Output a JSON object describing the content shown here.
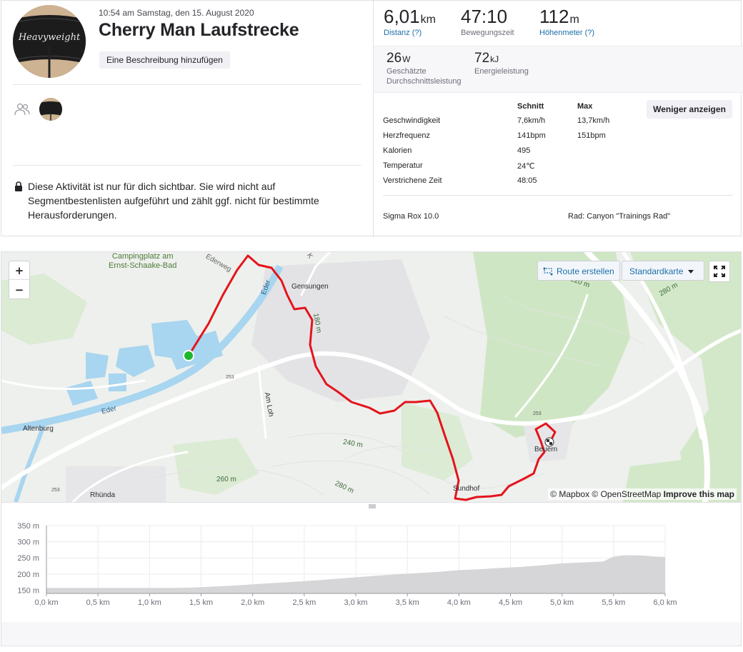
{
  "activity": {
    "datetime": "10:54 am Samstag, den 15. August 2020",
    "title": "Cherry Man Laufstrecke",
    "add_description": "Eine Beschreibung hinzufügen",
    "avatar_text": "Heavyweight",
    "privacy_note": "Diese Aktivität ist nur für dich sichtbar. Sie wird nicht auf Segmentbestenlisten aufgeführt und zählt ggf. nicht für bestimmte Herausforderungen."
  },
  "stats": {
    "distance": {
      "value": "6,01",
      "unit": "km",
      "label": "Distanz (?)"
    },
    "moving_time": {
      "value": "47:10",
      "label": "Bewegungszeit"
    },
    "elevation": {
      "value": "112",
      "unit": "m",
      "label": "Höhenmeter (?)"
    },
    "power": {
      "value": "26",
      "unit": "W",
      "label_1": "Geschätzte",
      "label_2": "Durchschnittsleistung"
    },
    "energy": {
      "value": "72",
      "unit": "kJ",
      "label": "Energieleistung"
    }
  },
  "details": {
    "col_avg": "Schnitt",
    "col_max": "Max",
    "less_button": "Weniger anzeigen",
    "rows": [
      {
        "label": "Geschwindigkeit",
        "avg": "7,6km/h",
        "max": "13,7km/h"
      },
      {
        "label": "Herzfrequenz",
        "avg": "141bpm",
        "max": "151bpm"
      },
      {
        "label": "Kalorien",
        "avg": "495",
        "max": ""
      },
      {
        "label": "Temperatur",
        "avg": "24℃",
        "max": ""
      },
      {
        "label": "Verstrichene Zeit",
        "avg": "48:05",
        "max": ""
      }
    ],
    "device": "Sigma Rox 10.0",
    "bike": "Rad: Canyon \"Trainings Rad\""
  },
  "map": {
    "zoom_in": "+",
    "zoom_out": "−",
    "route_button": "Route erstellen",
    "map_type": "Standardkarte",
    "attribution_1": "© Mapbox © OpenStreetMap",
    "attribution_2": "Improve this map",
    "labels": {
      "camp": "Campingplatz am",
      "camp2": "Ernst-Schaake-Bad",
      "ederweg": "Ederweg",
      "gensungen": "Gensungen",
      "eder1": "Eder",
      "eder2": "Eder",
      "altenburg": "Altenburg",
      "am_loh": "Am Loh",
      "rhunda": "Rhünda",
      "sundhof": "Sundhof",
      "beuern": "Beuern",
      "c180": "180 m",
      "c240": "240 m",
      "c260a": "260 m",
      "c280a": "280 m",
      "c280b": "280 m",
      "c220": "220 m",
      "r253a": "253",
      "r253b": "253",
      "r253c": "253",
      "k": "K"
    },
    "colors": {
      "route": "#e4141b",
      "start": "#1db82a",
      "water": "#a8d5ef",
      "forest": "#cfe6c4"
    }
  },
  "chart_data": {
    "type": "area",
    "ylabel": "",
    "xlabel": "",
    "x_ticks": [
      "0,0 km",
      "0,5 km",
      "1,0 km",
      "1,5 km",
      "2,0 km",
      "2,5 km",
      "3,0 km",
      "3,5 km",
      "4,0 km",
      "4,5 km",
      "5,0 km",
      "5,5 km",
      "6,0 km"
    ],
    "y_ticks": [
      "350 m",
      "300 m",
      "250 m",
      "200 m",
      "150 m"
    ],
    "xlim": [
      0,
      6.0
    ],
    "ylim": [
      140,
      350
    ],
    "grid": true,
    "series": [
      {
        "x": [
          0,
          0.2,
          0.4,
          0.6,
          0.8,
          1.0,
          1.2,
          1.4,
          1.6,
          1.8,
          2.0,
          2.2,
          2.4,
          2.6,
          2.8,
          3.0,
          3.2,
          3.4,
          3.6,
          3.8,
          4.0,
          4.2,
          4.4,
          4.6,
          4.8,
          5.0,
          5.2,
          5.4,
          5.5,
          5.6,
          5.7,
          5.8,
          5.9,
          6.0
        ],
        "y": [
          157,
          157,
          157,
          157,
          157,
          157,
          157,
          158,
          161,
          164,
          168,
          172,
          176,
          180,
          185,
          190,
          195,
          199,
          203,
          207,
          212,
          215,
          219,
          222,
          227,
          233,
          236,
          239,
          254,
          258,
          258,
          257,
          254,
          253
        ]
      }
    ],
    "color": "#d6d6d8"
  }
}
